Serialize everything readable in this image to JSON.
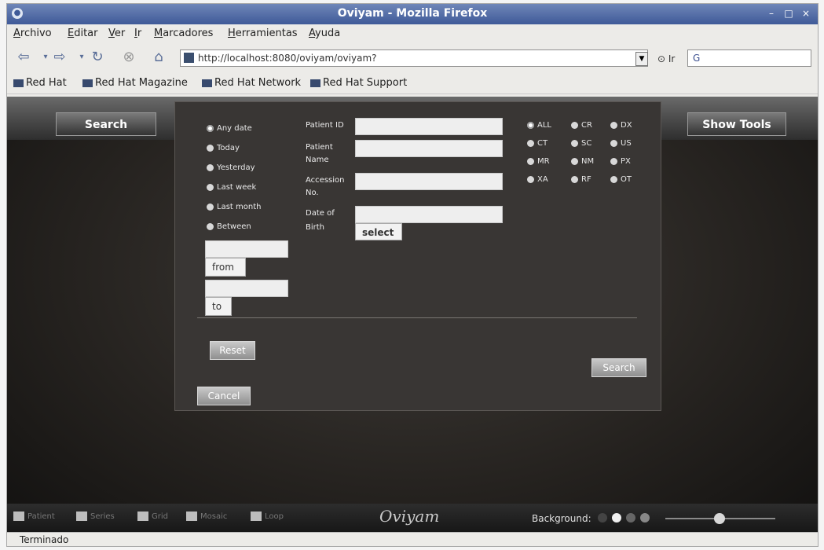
{
  "window": {
    "title": "Oviyam - Mozilla Firefox",
    "controls": [
      "–",
      "□",
      "×"
    ]
  },
  "menu": [
    "Archivo",
    "Editar",
    "Ver",
    "Ir",
    "Marcadores",
    "Herramientas",
    "Ayuda"
  ],
  "nav": {
    "url": "http://localhost:8080/oviyam/oviyam?",
    "go_label": "Ir",
    "search_value": "G"
  },
  "bookmarks": [
    "Red Hat",
    "Red Hat Magazine",
    "Red Hat Network",
    "Red Hat Support"
  ],
  "app": {
    "search_tab": "Search",
    "show_tools": "Show Tools",
    "dialog": {
      "date_options": [
        "Any date",
        "Today",
        "Yesterday",
        "Last week",
        "Last month",
        "Between"
      ],
      "from_label": "from",
      "to_label": "to",
      "patient_id_label": "Patient ID",
      "patient_name_label_1": "Patient",
      "patient_name_label_2": "Name",
      "accession_label_1": "Accession",
      "accession_label_2": "No.",
      "dob_label_1": "Date of",
      "dob_label_2": "Birth",
      "select_label": "select",
      "modalities": [
        "ALL",
        "CR",
        "DX",
        "CT",
        "SC",
        "US",
        "MR",
        "NM",
        "PX",
        "XA",
        "RF",
        "OT"
      ],
      "reset_label": "Reset",
      "search_label": "Search",
      "cancel_label": "Cancel"
    },
    "bottom": {
      "items": [
        "Patient",
        "Series",
        "Grid",
        "Mosaic",
        "Loop"
      ],
      "logo": "Oviyam",
      "background_label": "Background:"
    }
  },
  "status": "Terminado"
}
